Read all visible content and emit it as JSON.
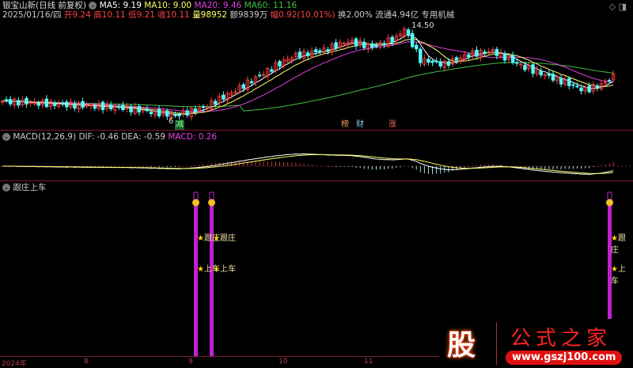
{
  "header": {
    "stock": "银宝山新(日线 前复权)",
    "ma5": "MA5: 9.19",
    "ma10": "MA10: 9.00",
    "ma20": "MA20: 9.46",
    "ma60": "MA60: 11.16"
  },
  "quote": {
    "date": "2025/01/16/四",
    "open": "开9.24",
    "high": "高10.11",
    "low": "低9.21",
    "close": "收10.11",
    "volume": "量98952",
    "amount": "额9839万",
    "change": "幅0.92(10.01%)",
    "turnover": "换2.00%",
    "float": "流通4.94亿",
    "sector": "专用机械"
  },
  "price_chart": {
    "high_label": "14.50",
    "low_label": "6",
    "tags": [
      "减",
      "榜",
      "财",
      "涨"
    ],
    "closes": [
      [
        0,
        7.6
      ],
      [
        15,
        7.3
      ],
      [
        30,
        7.0
      ],
      [
        43,
        6.3
      ],
      [
        50,
        7.0
      ],
      [
        58,
        8.6
      ],
      [
        66,
        10.4
      ],
      [
        72,
        11.7
      ],
      [
        80,
        12.3
      ],
      [
        86,
        13.1
      ],
      [
        92,
        12.6
      ],
      [
        98,
        13.4
      ],
      [
        100,
        14.3
      ],
      [
        104,
        11.4
      ],
      [
        110,
        11.0
      ],
      [
        116,
        11.9
      ],
      [
        122,
        12.2
      ],
      [
        130,
        10.7
      ],
      [
        138,
        9.6
      ],
      [
        145,
        8.6
      ],
      [
        150,
        9.3
      ],
      [
        152,
        10.11
      ]
    ],
    "colors": {
      "up": "#ff4040",
      "down": "#54fcfc",
      "ma5": "#ffffff",
      "ma10": "#ffff66",
      "ma20": "#e040e0",
      "ma60": "#40c040"
    }
  },
  "macd": {
    "label": "MACD(12,26,9)",
    "dif": "DIF: -0.46",
    "dea": "DEA: -0.59",
    "macd": "MACD: 0.26"
  },
  "indicator": {
    "title": "跟庄上车",
    "signal1": "跟庄",
    "signal2": "上车",
    "signal_bars": [
      48,
      52,
      151
    ]
  },
  "axis": {
    "labels": [
      "2024年",
      "8",
      "9",
      "10",
      "11"
    ]
  },
  "watermark": {
    "logo_char": "股",
    "site_name": "公式之家",
    "url": "www.gszj100.com"
  }
}
